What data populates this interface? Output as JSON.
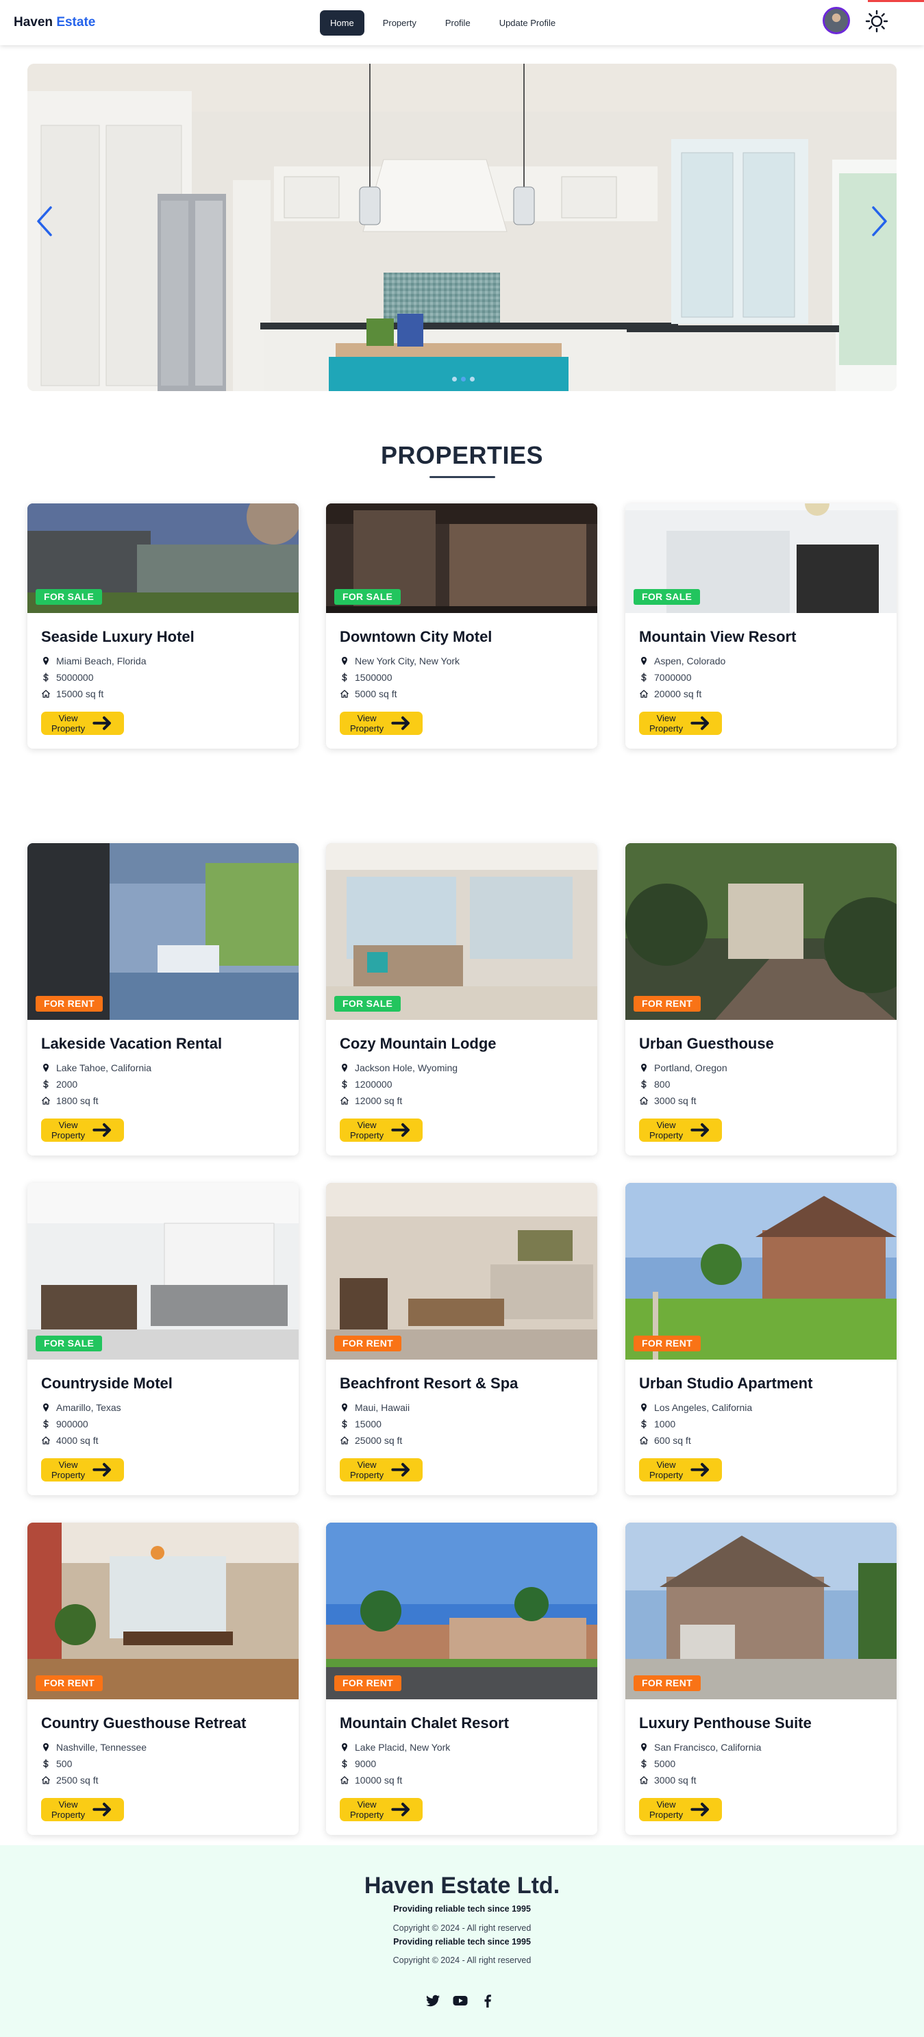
{
  "nav": {
    "brand_first": "Haven",
    "brand_second": "Estate",
    "links": [
      "Home",
      "Property",
      "Profile",
      "Update Profile"
    ],
    "active": "Home",
    "avatar_icon": "user-avatar",
    "theme_icon": "sun-icon"
  },
  "hero": {
    "image": "white-kitchen-interior",
    "prev_icon": "chevron-left-icon",
    "next_icon": "chevron-right-icon",
    "slide_count": 3,
    "active_slide": 1
  },
  "section": {
    "title": "PROPERTIES"
  },
  "properties": [
    {
      "title": "Seaside Luxury Hotel",
      "location": "Miami Beach, Florida",
      "price": "5000000",
      "area": "15000 sq ft",
      "status": "FOR SALE",
      "button": "View Property"
    },
    {
      "title": "Downtown City Motel",
      "location": "New York City, New York",
      "price": "1500000",
      "area": "5000 sq ft",
      "status": "FOR SALE",
      "button": "View Property"
    },
    {
      "title": "Mountain View Resort",
      "location": "Aspen, Colorado",
      "price": "7000000",
      "area": "20000 sq ft",
      "status": "FOR SALE",
      "button": "View Property"
    },
    {
      "title": "Lakeside Vacation Rental",
      "location": "Lake Tahoe, California",
      "price": "2000",
      "area": "1800 sq ft",
      "status": "FOR RENT",
      "button": "View Property"
    },
    {
      "title": "Cozy Mountain Lodge",
      "location": "Jackson Hole, Wyoming",
      "price": "1200000",
      "area": "12000 sq ft",
      "status": "FOR SALE",
      "button": "View Property"
    },
    {
      "title": "Urban Guesthouse",
      "location": "Portland, Oregon",
      "price": "800",
      "area": "3000 sq ft",
      "status": "FOR RENT",
      "button": "View Property"
    },
    {
      "title": "Countryside Motel",
      "location": "Amarillo, Texas",
      "price": "900000",
      "area": "4000 sq ft",
      "status": "FOR SALE",
      "button": "View Property"
    },
    {
      "title": "Beachfront Resort & Spa",
      "location": "Maui, Hawaii",
      "price": "15000",
      "area": "25000 sq ft",
      "status": "FOR RENT",
      "button": "View Property"
    },
    {
      "title": "Urban Studio Apartment",
      "location": "Los Angeles, California",
      "price": "1000",
      "area": "600 sq ft",
      "status": "FOR RENT",
      "button": "View Property"
    },
    {
      "title": "Country Guesthouse Retreat",
      "location": "Nashville, Tennessee",
      "price": "500",
      "area": "2500 sq ft",
      "status": "FOR RENT",
      "button": "View Property"
    },
    {
      "title": "Mountain Chalet Resort",
      "location": "Lake Placid, New York",
      "price": "9000",
      "area": "10000 sq ft",
      "status": "FOR RENT",
      "button": "View Property"
    },
    {
      "title": "Luxury Penthouse Suite",
      "location": "San Francisco, California",
      "price": "5000",
      "area": "3000 sq ft",
      "status": "FOR RENT",
      "button": "View Property"
    }
  ],
  "footer": {
    "company": "Haven Estate Ltd.",
    "tagline": "Providing reliable tech since 1995",
    "copyright": "Copyright © 2024 - All right reserved",
    "tagline_2": "Providing reliable tech since 1995",
    "copyright_2": "Copyright © 2024 - All right reserved",
    "social": [
      "twitter-icon",
      "youtube-icon",
      "facebook-icon"
    ]
  },
  "colors": {
    "accent": "#2563eb",
    "nav_active": "#1e293b",
    "button": "#facc15",
    "sale_badge": "#22c55e",
    "rent_badge": "#f97316",
    "footer_bg": "#ecfdf5"
  }
}
